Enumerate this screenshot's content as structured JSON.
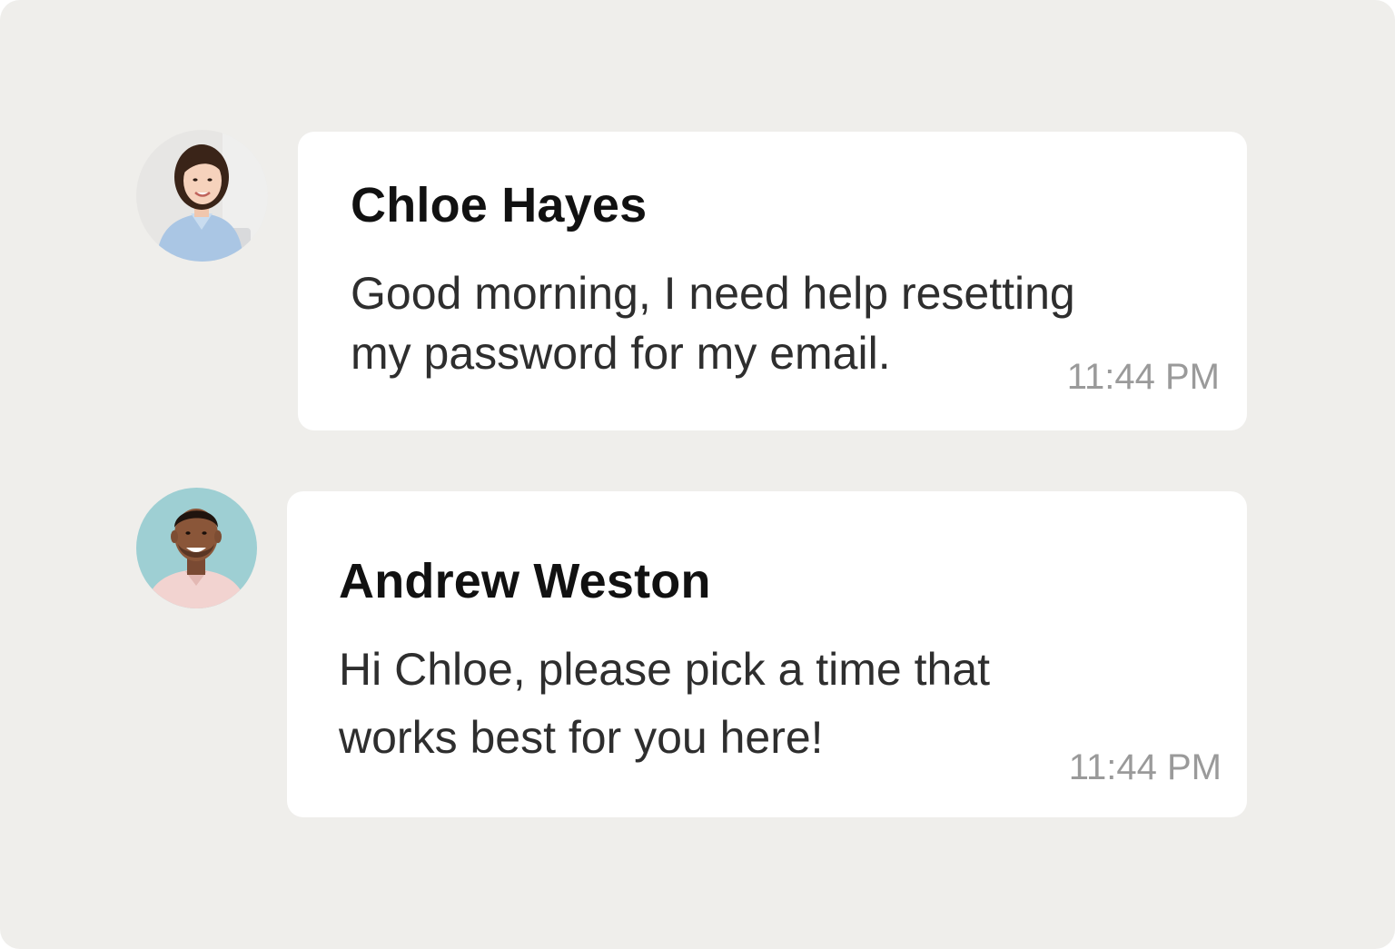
{
  "messages": [
    {
      "sender": "Chloe Hayes",
      "text": "Good morning, I need help resetting\nmy password for my email.",
      "time": "11:44 PM",
      "avatar": "woman-avatar-icon"
    },
    {
      "sender": "Andrew Weston",
      "text": "Hi Chloe, please pick a time that\nworks best for you here!",
      "time": "11:44 PM",
      "avatar": "man-avatar-icon"
    }
  ],
  "colors": {
    "background": "#efeeeb",
    "bubble": "#ffffff",
    "sender_text": "#111111",
    "message_text": "#2e2e2e",
    "timestamp_text": "#9a9a9a"
  }
}
